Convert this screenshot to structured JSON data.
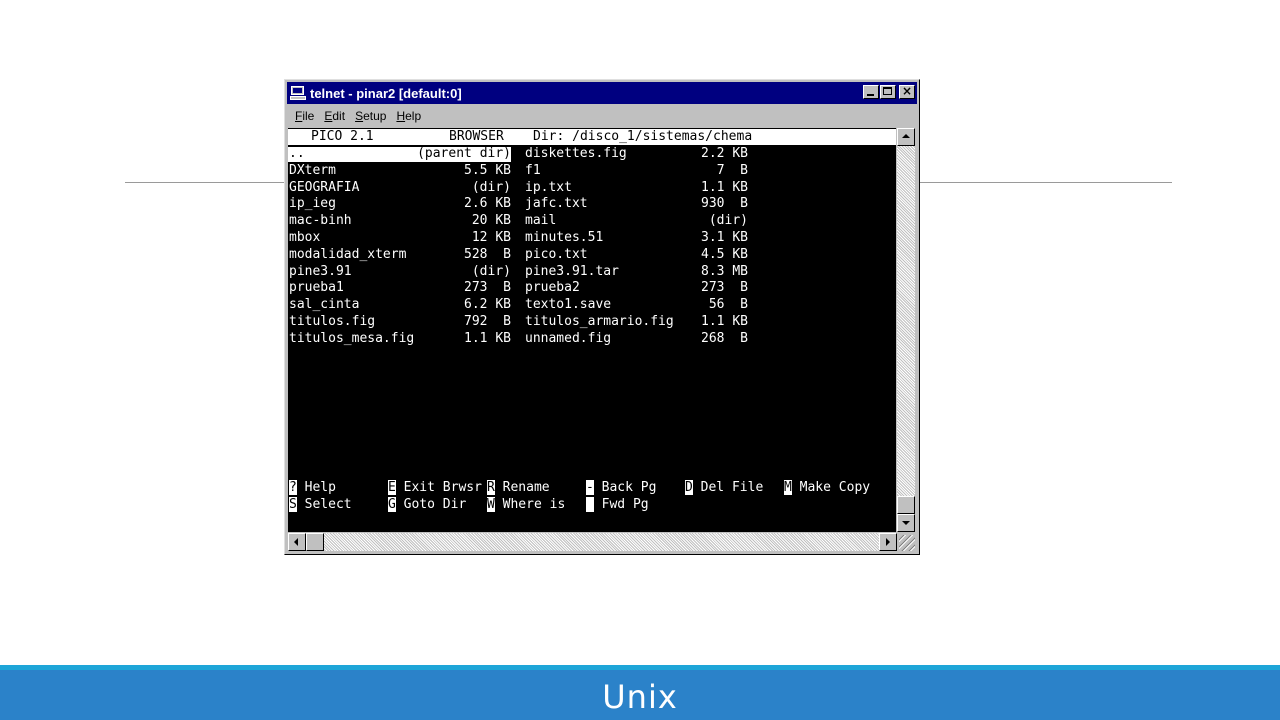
{
  "window": {
    "title": "telnet - pinar2 [default:0]",
    "icons": {
      "app": "terminal-icon",
      "minimize": "minimize-icon",
      "maximize": "maximize-icon",
      "close": "close-icon"
    }
  },
  "menu": {
    "items": [
      {
        "mnemonic": "F",
        "rest": "ile"
      },
      {
        "mnemonic": "E",
        "rest": "dit"
      },
      {
        "mnemonic": "S",
        "rest": "etup"
      },
      {
        "mnemonic": "H",
        "rest": "elp"
      }
    ]
  },
  "terminal": {
    "header": {
      "app": "PICO 2.1",
      "mode": "BROWSER",
      "dir": "Dir: /disco_1/sistemas/chema"
    },
    "files": [
      {
        "name": "..",
        "size": "(parent dir)",
        "name2": "diskettes.fig",
        "size2": "2.2 KB"
      },
      {
        "name": "DXterm",
        "size": "5.5 KB",
        "name2": "f1",
        "size2": "7  B"
      },
      {
        "name": "GEOGRAFIA",
        "size": "(dir)",
        "name2": "ip.txt",
        "size2": "1.1 KB"
      },
      {
        "name": "ip_ieg",
        "size": "2.6 KB",
        "name2": "jafc.txt",
        "size2": "930  B"
      },
      {
        "name": "mac-binh",
        "size": "20 KB",
        "name2": "mail",
        "size2": "(dir)"
      },
      {
        "name": "mbox",
        "size": "12 KB",
        "name2": "minutes.51",
        "size2": "3.1 KB"
      },
      {
        "name": "modalidad_xterm",
        "size": "528  B",
        "name2": "pico.txt",
        "size2": "4.5 KB"
      },
      {
        "name": "pine3.91",
        "size": "(dir)",
        "name2": "pine3.91.tar",
        "size2": "8.3 MB"
      },
      {
        "name": "prueba1",
        "size": "273  B",
        "name2": "prueba2",
        "size2": "273  B"
      },
      {
        "name": "sal_cinta",
        "size": "6.2 KB",
        "name2": "texto1.save",
        "size2": "56  B"
      },
      {
        "name": "titulos.fig",
        "size": "792  B",
        "name2": "titulos_armario.fig",
        "size2": "1.1 KB"
      },
      {
        "name": "titulos_mesa.fig",
        "size": "1.1 KB",
        "name2": "unnamed.fig",
        "size2": "268  B"
      }
    ],
    "commands": [
      {
        "key": "?",
        "label": " Help"
      },
      {
        "key": "E",
        "label": " Exit Brwsr"
      },
      {
        "key": "R",
        "label": " Rename"
      },
      {
        "key": "-",
        "label": " Back Pg"
      },
      {
        "key": "D",
        "label": " Del File"
      },
      {
        "key": "M",
        "label": " Make Copy"
      },
      {
        "key": "S",
        "label": " Select"
      },
      {
        "key": "G",
        "label": " Goto Dir"
      },
      {
        "key": "W",
        "label": " Where is"
      },
      {
        "key": " ",
        "label": " Fwd Pg"
      }
    ]
  },
  "slide": {
    "title": "Unix",
    "accent": "#2b82c9",
    "accent_top": "#1ea5d8"
  }
}
